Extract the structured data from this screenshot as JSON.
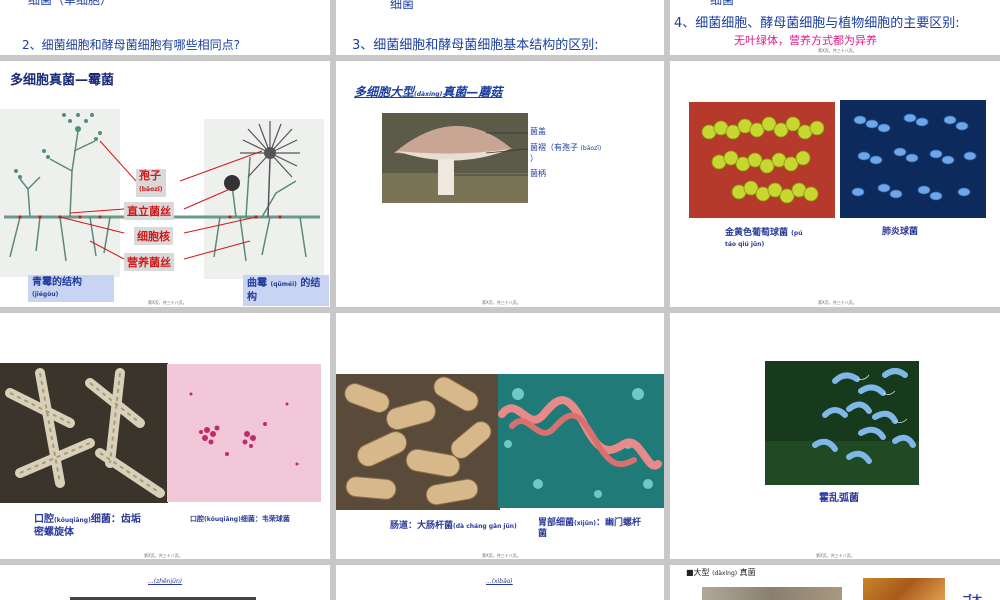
{
  "slide1": {
    "line1": "细菌（单细胞）",
    "line2": "2、细菌细胞和酵母菌细胞有哪些相同点?"
  },
  "slide2": {
    "line1": "细菌",
    "line2": "3、细菌细胞和酵母菌细胞基本结构的区别:"
  },
  "slide3": {
    "line0": "细菌",
    "line1": "4、细菌细胞、酵母菌细胞与植物细胞的主要区别:",
    "line2": "无叶绿体，营养方式都为异养",
    "footer": "第X页，共三十八页。"
  },
  "slide4": {
    "title": "多细胞真菌—霉菌",
    "labels": {
      "spore": "孢子",
      "spore_pinyin": "(bāozǐ)",
      "aerial": "直立菌丝",
      "cell_wall": "细胞核",
      "nutrient": "营养菌丝"
    },
    "caption_left": "青霉的结构",
    "caption_left_pinyin": "(jiégòu)",
    "caption_right": "曲霉",
    "caption_right_pinyin": "(qūméi)",
    "caption_right_tail": "的结构",
    "footer": "第X页，共三十八页。"
  },
  "slide5": {
    "title_a": "多细胞大型",
    "title_pinyin": "(dàxíng)",
    "title_b": "真菌—蘑菇",
    "cap": "菌盖",
    "gill": "菌褶（有孢子",
    "gill_pinyin": "(bāozǐ)",
    "gill_tail": "）",
    "stem": "菌柄",
    "footer": "第X页，共三十八页。"
  },
  "slide6": {
    "left_caption": "金黄色葡萄球菌",
    "left_pinyin": "(pú",
    "left_pinyin2": "táo qiú jūn)",
    "right_caption": "肺炎球菌",
    "footer": "第X页，共三十八页。"
  },
  "slide7": {
    "cap1_a": "口腔",
    "cap1_pinyin": "(kǒuqiāng)",
    "cap1_b": "细菌：齿垢",
    "cap1_line2": "密螺旋体",
    "cap2_a": "口腔",
    "cap2_pinyin": "(kǒuqiāng)",
    "cap2_b": "细菌：韦荣球菌",
    "footer": "第X页，共三十八页。"
  },
  "slide8": {
    "cap1_a": "肠道：大肠杆菌",
    "cap1_pinyin": "(dà cháng gǎn jūn)",
    "cap2_a": "胃部细菌",
    "cap2_pinyin": "(xìjūn)",
    "cap2_b": "：幽门螺杆",
    "cap2_line2": "菌",
    "footer": "第X页，共三十八页。"
  },
  "slide9": {
    "caption": "霍乱弧菌",
    "footer": "第X页，共三十八页。"
  },
  "slide10": {
    "text": "...(zhēnjūn)"
  },
  "slide11": {
    "text": "...(xìbāo)"
  },
  "slide12": {
    "bullet": "■大型",
    "pinyin": "(dàxíng)",
    "tail": "真菌",
    "partial": "ゴ太"
  },
  "colors": {
    "title_blue": "#1a3fa0",
    "accent_pink": "#e0198a",
    "label_red": "#d01818",
    "caption_bg": "#c9d3f2"
  }
}
